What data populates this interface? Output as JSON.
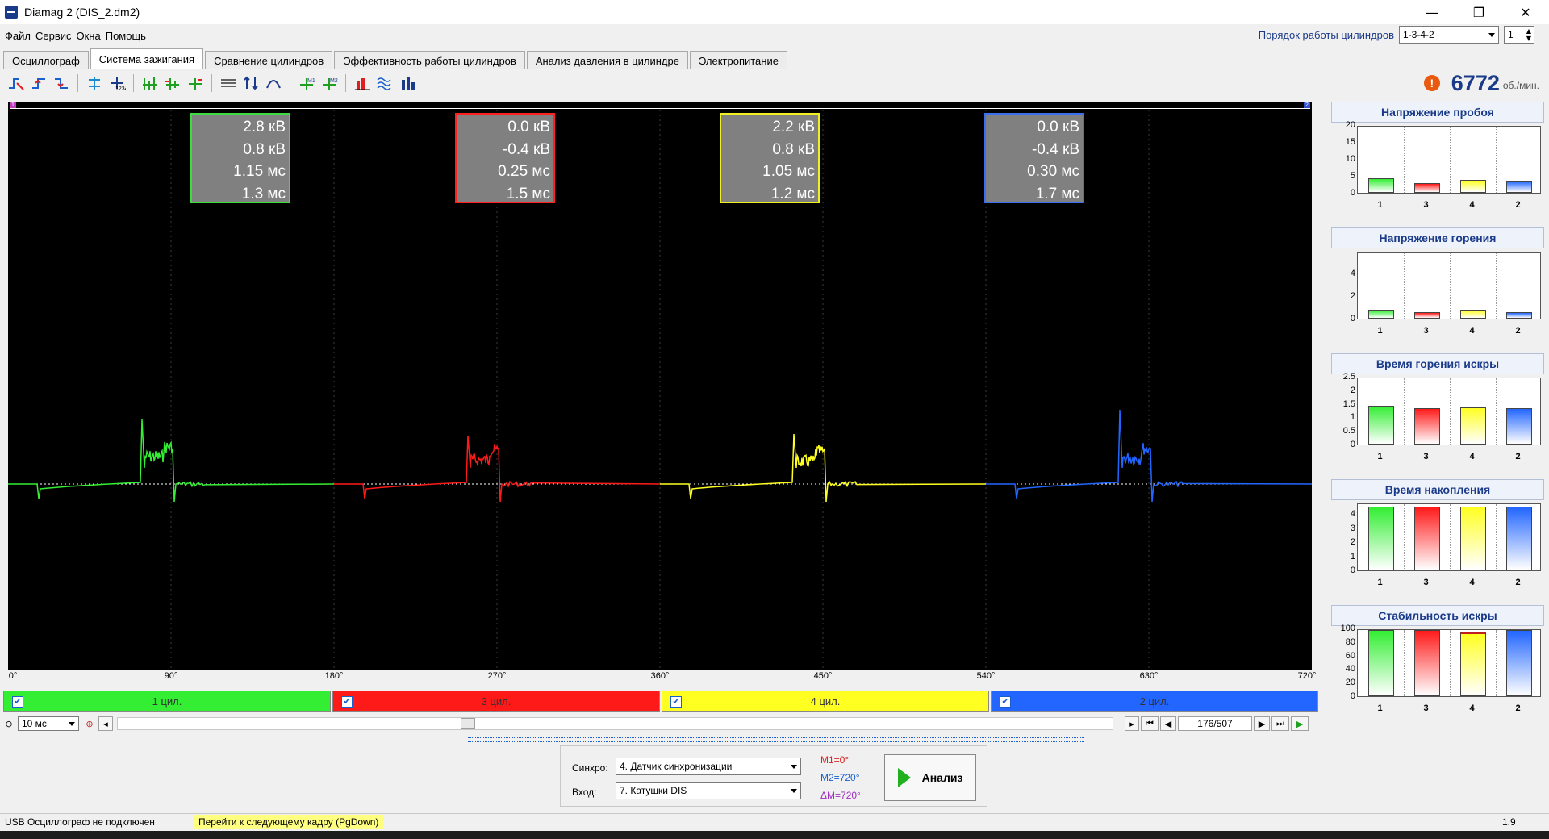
{
  "window": {
    "title": "Diamag 2 (DIS_2.dm2)",
    "min": "—",
    "restore": "❐",
    "close": "✕"
  },
  "menu": [
    "Файл",
    "Сервис",
    "Окна",
    "Помощь"
  ],
  "cylinder_order": {
    "label": "Порядок работы цилиндров",
    "value": "1-3-4-2",
    "number": "1"
  },
  "tabs": [
    "Осциллограф",
    "Система зажигания",
    "Сравнение цилиндров",
    "Эффективность работы цилиндров",
    "Анализ давления в цилиндре",
    "Электропитание"
  ],
  "active_tab": 1,
  "rpm": {
    "value": "6772",
    "unit": "об./мин.",
    "warn": "!"
  },
  "scope": {
    "markers": [
      "1",
      "2"
    ],
    "info_boxes": [
      {
        "lines": [
          "2.8 кВ",
          "0.8 кВ",
          "1.15 мс",
          "1.3 мс"
        ],
        "color": "#3fdc3f"
      },
      {
        "lines": [
          "0.0 кВ",
          "-0.4 кВ",
          "0.25 мс",
          "1.5 мс"
        ],
        "color": "#ff2020"
      },
      {
        "lines": [
          "2.2 кВ",
          "0.8 кВ",
          "1.05 мс",
          "1.2 мс"
        ],
        "color": "#f0f020"
      },
      {
        "lines": [
          "0.0 кВ",
          "-0.4 кВ",
          "0.30 мс",
          "1.7 мс"
        ],
        "color": "#3a70f0"
      }
    ],
    "degrees": [
      "0°",
      "90°",
      "180°",
      "270°",
      "360°",
      "450°",
      "540°",
      "630°",
      "720°"
    ]
  },
  "cylinders": [
    {
      "label": "1 цил.",
      "color": "#33ee33",
      "check": "✔"
    },
    {
      "label": "3 цил.",
      "color": "#ff1a1a",
      "check": "✔"
    },
    {
      "label": "4 цил.",
      "color": "#ffff22",
      "check": "✔"
    },
    {
      "label": "2 цил.",
      "color": "#2266ff",
      "check": "✔"
    }
  ],
  "timeline": {
    "timebase": "10 мс",
    "frame": "176/507",
    "zoom_out": "⊖",
    "zoom_in": "⊕",
    "prev_small": "◂",
    "next_small": "▸",
    "first": "⏮",
    "prev": "◀",
    "next": "▶",
    "last": "⏭",
    "play": "▶"
  },
  "controls": {
    "sync_label": "Синхро:",
    "sync_value": "4.  Датчик синхронизации",
    "input_label": "Вход:",
    "input_value": "7.  Катушки DIS",
    "m1": "M1=0°",
    "m2": "M2=720°",
    "dm": "ΔM=720°",
    "analysis": "Анализ"
  },
  "status": {
    "left": "USB Осциллограф не подключен",
    "hint": "Перейти к следующему кадру (PgDown)",
    "version": "1.9"
  },
  "side_charts": [
    {
      "title": "Напряжение пробоя",
      "ticks": [
        "20",
        "15",
        "10",
        "5",
        "0"
      ],
      "max": 20,
      "categories": [
        "1",
        "3",
        "4",
        "2"
      ],
      "values": [
        4.5,
        3.0,
        3.8,
        3.6
      ]
    },
    {
      "title": "Напряжение горения",
      "ticks": [
        "4",
        "2",
        "0"
      ],
      "max": 6,
      "categories": [
        "1",
        "3",
        "4",
        "2"
      ],
      "values": [
        0.8,
        0.6,
        0.8,
        0.6
      ]
    },
    {
      "title": "Время горения искры",
      "ticks": [
        "2.5",
        "2",
        "1.5",
        "1",
        "0.5",
        "0"
      ],
      "max": 2.5,
      "categories": [
        "1",
        "3",
        "4",
        "2"
      ],
      "values": [
        1.45,
        1.38,
        1.4,
        1.38
      ]
    },
    {
      "title": "Время накопления",
      "ticks": [
        "4",
        "3",
        "2",
        "1",
        "0"
      ],
      "max": 4.8,
      "categories": [
        "1",
        "3",
        "4",
        "2"
      ],
      "values": [
        4.6,
        4.6,
        4.6,
        4.6
      ]
    },
    {
      "title": "Стабильность искры",
      "ticks": [
        "100",
        "80",
        "60",
        "40",
        "20",
        "0"
      ],
      "max": 100,
      "categories": [
        "1",
        "3",
        "4",
        "2"
      ],
      "values": [
        100,
        100,
        97,
        100
      ]
    }
  ]
}
